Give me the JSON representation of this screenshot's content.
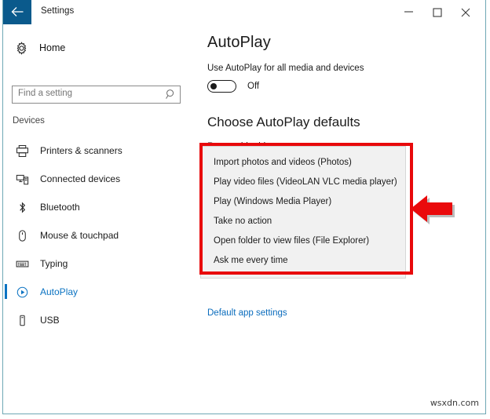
{
  "window": {
    "title": "Settings",
    "back_icon": "back-arrow-icon",
    "controls": {
      "minimize": "minimize-icon",
      "maximize": "maximize-icon",
      "close": "close-icon"
    }
  },
  "sidebar": {
    "home": {
      "label": "Home",
      "icon": "gear-icon"
    },
    "search": {
      "placeholder": "Find a setting",
      "icon": "search-icon",
      "value": ""
    },
    "section_label": "Devices",
    "items": [
      {
        "label": "Printers & scanners",
        "icon": "printer-icon",
        "selected": false
      },
      {
        "label": "Connected devices",
        "icon": "connected-devices-icon",
        "selected": false
      },
      {
        "label": "Bluetooth",
        "icon": "bluetooth-icon",
        "selected": false
      },
      {
        "label": "Mouse & touchpad",
        "icon": "mouse-icon",
        "selected": false
      },
      {
        "label": "Typing",
        "icon": "keyboard-icon",
        "selected": false
      },
      {
        "label": "AutoPlay",
        "icon": "autoplay-icon",
        "selected": true
      },
      {
        "label": "USB",
        "icon": "usb-icon",
        "selected": false
      }
    ]
  },
  "main": {
    "page_title": "AutoPlay",
    "toggle": {
      "label": "Use AutoPlay for all media and devices",
      "state": "Off",
      "on": false
    },
    "section_title": "Choose AutoPlay defaults",
    "field_caption": "Removable drive",
    "dropdown_options": [
      "Import photos and videos (Photos)",
      "Play video files (VideoLAN VLC media player)",
      "Play (Windows Media Player)",
      "Take no action",
      "Open folder to view files (File Explorer)",
      "Ask me every time"
    ],
    "link": "Default app settings"
  },
  "annotations": {
    "highlight_color": "#e8090b",
    "arrow_icon": "left-arrow-annotation-icon"
  },
  "watermark": "wsxdn.com",
  "colors": {
    "accent": "#0b73c2",
    "titlebar_back": "#0a5a8c",
    "link": "#0a6cbd",
    "window_border": "#6fa8b5",
    "dropdown_bg": "#f1f1f1"
  }
}
